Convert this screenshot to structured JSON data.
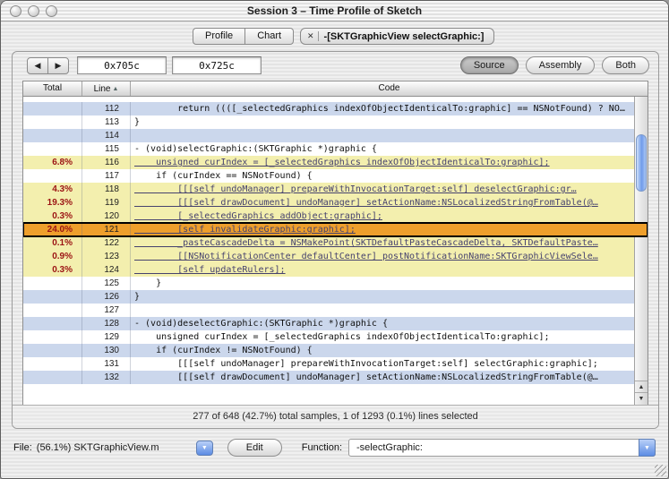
{
  "window": {
    "title": "Session 3 – Time Profile of Sketch"
  },
  "icons": {
    "back": "◀",
    "forward": "▶",
    "popup_arrow": "▼",
    "close_tab": "✕",
    "sort_asc": "▲",
    "scroll_up": "▲",
    "scroll_down": "▼"
  },
  "tab_bar": {
    "segments": [
      {
        "label": "Profile"
      },
      {
        "label": "Chart"
      }
    ],
    "document_tab": {
      "label": "-[SKTGraphicView selectGraphic:]"
    }
  },
  "toolbar": {
    "address_start": "0x705c",
    "address_end": "0x725c",
    "view_modes": [
      {
        "label": "Source",
        "selected": true
      },
      {
        "label": "Assembly",
        "selected": false
      },
      {
        "label": "Both",
        "selected": false
      }
    ]
  },
  "table": {
    "columns": [
      {
        "label": "Total"
      },
      {
        "label": "Line"
      },
      {
        "label": "Code"
      }
    ],
    "rows": [
      {
        "total": "",
        "line": "112",
        "code": "        return ((([_selectedGraphics indexOfObjectIdenticalTo:graphic] == NSNotFound) ? NO…",
        "highlight": "",
        "link": false
      },
      {
        "total": "",
        "line": "113",
        "code": "}",
        "highlight": "",
        "link": false
      },
      {
        "total": "",
        "line": "114",
        "code": "",
        "highlight": "",
        "link": false
      },
      {
        "total": "",
        "line": "115",
        "code": "- (void)selectGraphic:(SKTGraphic *)graphic {",
        "highlight": "",
        "link": false
      },
      {
        "total": "6.8%",
        "line": "116",
        "code": "    unsigned curIndex = [_selectedGraphics indexOfObjectIdenticalTo:graphic];",
        "highlight": "hot",
        "link": true
      },
      {
        "total": "",
        "line": "117",
        "code": "    if (curIndex == NSNotFound) {",
        "highlight": "",
        "link": false
      },
      {
        "total": "4.3%",
        "line": "118",
        "code": "        [[[self undoManager] prepareWithInvocationTarget:self] deselectGraphic:gr…",
        "highlight": "hot",
        "link": true
      },
      {
        "total": "19.3%",
        "line": "119",
        "code": "        [[[self drawDocument] undoManager] setActionName:NSLocalizedStringFromTable(@…",
        "highlight": "hot",
        "link": true
      },
      {
        "total": "0.3%",
        "line": "120",
        "code": "        [_selectedGraphics addObject:graphic];",
        "highlight": "hot",
        "link": true
      },
      {
        "total": "24.0%",
        "line": "121",
        "code": "        [self invalidateGraphic:graphic];",
        "highlight": "selected",
        "link": true
      },
      {
        "total": "0.1%",
        "line": "122",
        "code": "        _pasteCascadeDelta = NSMakePoint(SKTDefaultPasteCascadeDelta, SKTDefaultPaste…",
        "highlight": "hot",
        "link": true
      },
      {
        "total": "0.9%",
        "line": "123",
        "code": "        [[NSNotificationCenter defaultCenter] postNotificationName:SKTGraphicViewSele…",
        "highlight": "hot",
        "link": true
      },
      {
        "total": "0.3%",
        "line": "124",
        "code": "        [self updateRulers];",
        "highlight": "hot",
        "link": true
      },
      {
        "total": "",
        "line": "125",
        "code": "    }",
        "highlight": "",
        "link": false
      },
      {
        "total": "",
        "line": "126",
        "code": "}",
        "highlight": "",
        "link": false
      },
      {
        "total": "",
        "line": "127",
        "code": "",
        "highlight": "",
        "link": false
      },
      {
        "total": "",
        "line": "128",
        "code": "- (void)deselectGraphic:(SKTGraphic *)graphic {",
        "highlight": "",
        "link": false
      },
      {
        "total": "",
        "line": "129",
        "code": "    unsigned curIndex = [_selectedGraphics indexOfObjectIdenticalTo:graphic];",
        "highlight": "",
        "link": false
      },
      {
        "total": "",
        "line": "130",
        "code": "    if (curIndex != NSNotFound) {",
        "highlight": "",
        "link": false
      },
      {
        "total": "",
        "line": "131",
        "code": "        [[[self undoManager] prepareWithInvocationTarget:self] selectGraphic:graphic];",
        "highlight": "",
        "link": false
      },
      {
        "total": "",
        "line": "132",
        "code": "        [[[self drawDocument] undoManager] setActionName:NSLocalizedStringFromTable(@…",
        "highlight": "",
        "link": false
      }
    ]
  },
  "status_bar": {
    "text": "277 of 648 (42.7%) total samples, 1 of 1293 (0.1%) lines selected"
  },
  "footer": {
    "file_label": "File:",
    "file_value": "(56.1%) SKTGraphicView.m",
    "edit_button": "Edit",
    "function_label": "Function:",
    "function_value": "-selectGraphic:"
  }
}
